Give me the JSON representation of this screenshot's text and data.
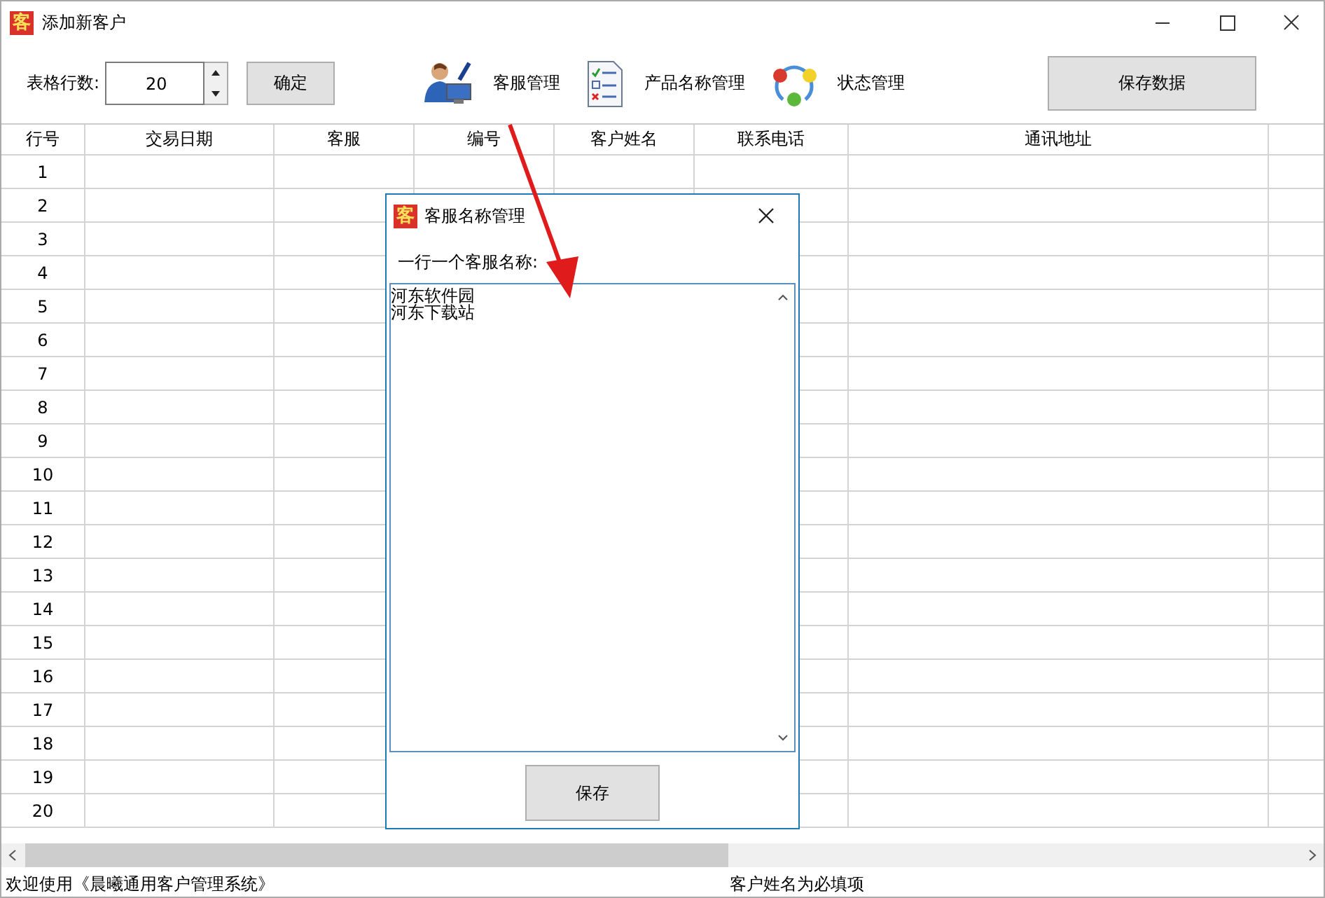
{
  "window": {
    "icon_char": "客",
    "title": "添加新客户"
  },
  "toolbar": {
    "rows_label": "表格行数:",
    "rows_value": "20",
    "confirm": "确定",
    "tools": [
      {
        "kind": "person",
        "label": "客服管理"
      },
      {
        "kind": "list",
        "label": "产品名称管理"
      },
      {
        "kind": "cycle",
        "label": "状态管理"
      }
    ],
    "save": "保存数据"
  },
  "table": {
    "columns": [
      "行号",
      "交易日期",
      "客服",
      "编号",
      "客户姓名",
      "联系电话",
      "通讯地址"
    ],
    "rows": [
      "1",
      "2",
      "3",
      "4",
      "5",
      "6",
      "7",
      "8",
      "9",
      "10",
      "11",
      "12",
      "13",
      "14",
      "15",
      "16",
      "17",
      "18",
      "19",
      "20"
    ]
  },
  "status_bar": {
    "left": "欢迎使用《晨曦通用客户管理系统》",
    "right": "客户姓名为必填项"
  },
  "dialog": {
    "icon_char": "客",
    "title": "客服名称管理",
    "prompt": "一行一个客服名称:",
    "lines": [
      "河东软件园",
      "河东下载站"
    ],
    "save": "保存"
  }
}
